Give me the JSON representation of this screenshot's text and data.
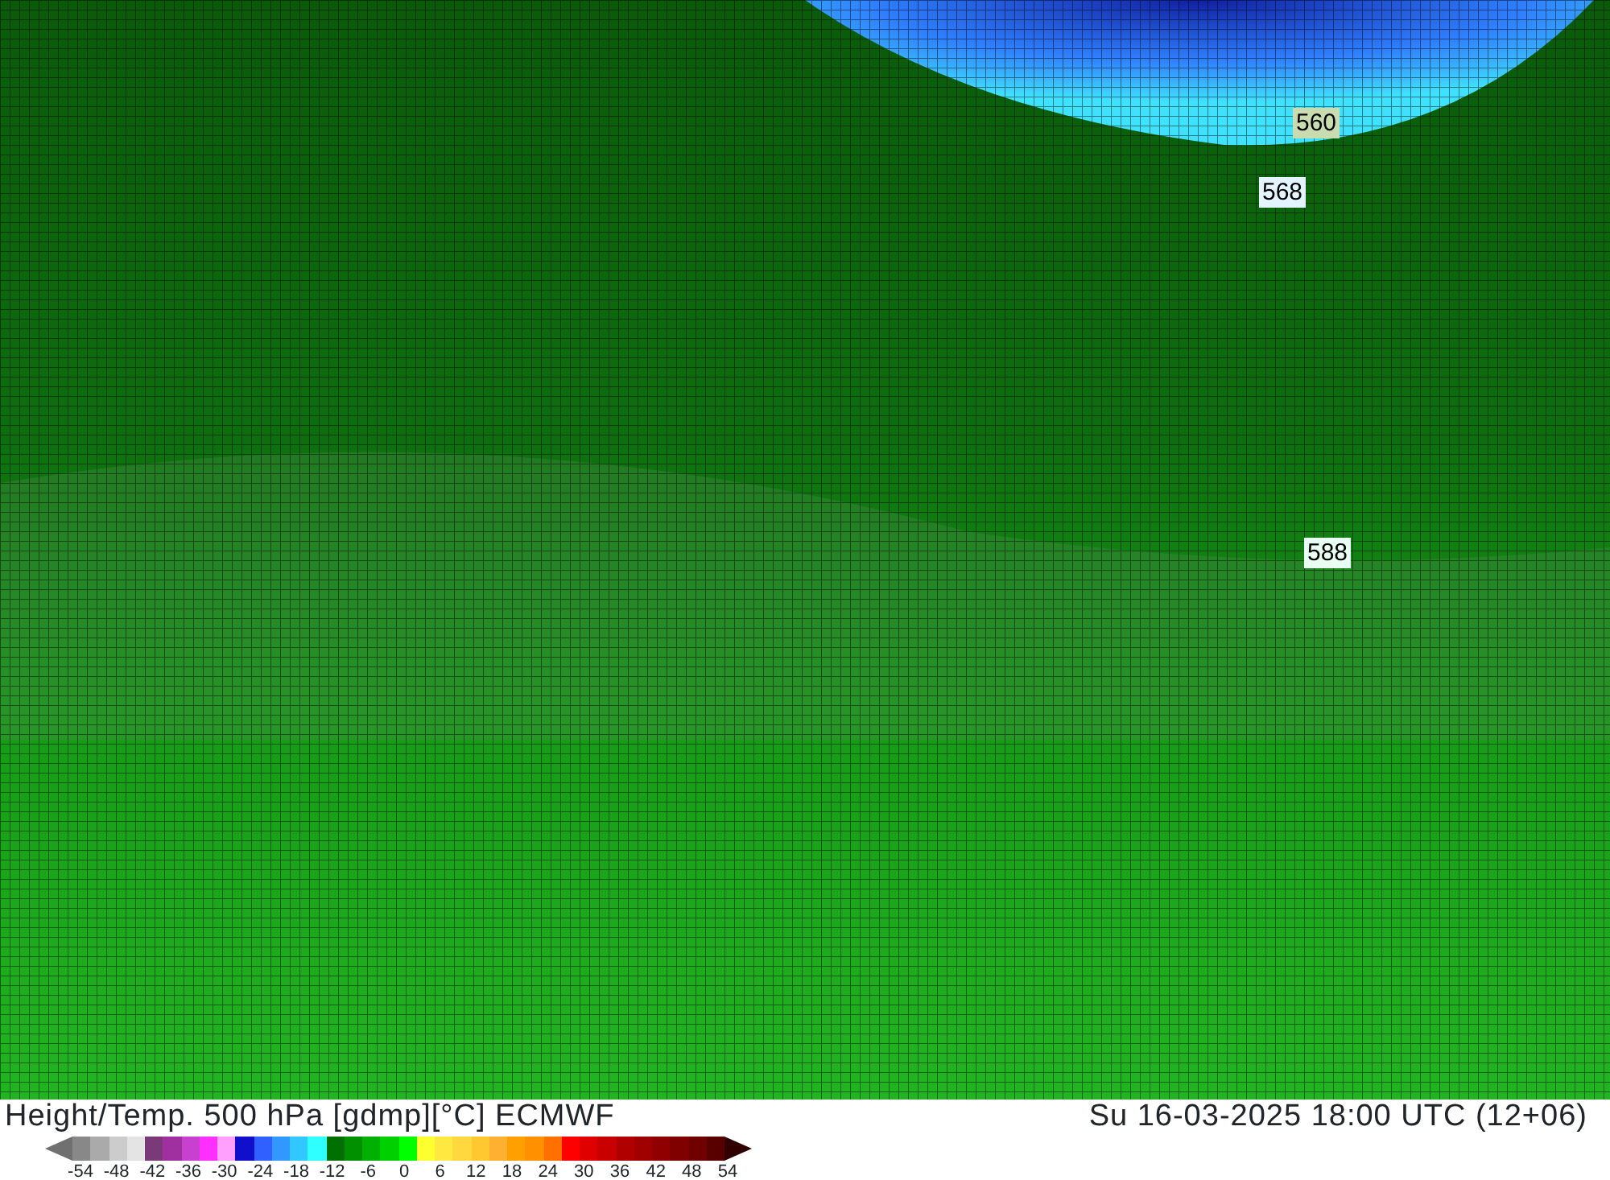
{
  "map": {
    "contour_labels": [
      {
        "text": "560",
        "color": "#c8dcb0"
      },
      {
        "text": "568",
        "color": "#e4f4ff"
      },
      {
        "text": "588",
        "color": "#e8fff4"
      }
    ]
  },
  "title": "Height/Temp. 500 hPa [gdmp][°C] ECMWF",
  "valid_time": "Su 16-03-2025 18:00 UTC (12+06)",
  "legend": {
    "arrows": [
      {
        "kind": "low",
        "color": "#707070"
      },
      {
        "kind": "high",
        "color": "#300000"
      }
    ],
    "swatches": [
      {
        "color": "#888888"
      },
      {
        "color": "#aaaaaa"
      },
      {
        "color": "#cccccc"
      },
      {
        "color": "#e4e4e4"
      },
      {
        "color": "#7a3a7a"
      },
      {
        "color": "#a030a0"
      },
      {
        "color": "#c840d0"
      },
      {
        "color": "#ff30ff"
      },
      {
        "color": "#ffa0ff"
      },
      {
        "color": "#1010cc"
      },
      {
        "color": "#3060ff"
      },
      {
        "color": "#3098ff"
      },
      {
        "color": "#30c8ff"
      },
      {
        "color": "#30ffff"
      },
      {
        "color": "#007000"
      },
      {
        "color": "#009000"
      },
      {
        "color": "#00b000"
      },
      {
        "color": "#00d000"
      },
      {
        "color": "#00ff00"
      },
      {
        "color": "#ffff30"
      },
      {
        "color": "#ffe840"
      },
      {
        "color": "#ffd840"
      },
      {
        "color": "#ffc830"
      },
      {
        "color": "#ffb030"
      },
      {
        "color": "#ffa000"
      },
      {
        "color": "#ff9000"
      },
      {
        "color": "#ff7000"
      },
      {
        "color": "#ff0000"
      },
      {
        "color": "#e00000"
      },
      {
        "color": "#c80000"
      },
      {
        "color": "#b00000"
      },
      {
        "color": "#a00000"
      },
      {
        "color": "#900000"
      },
      {
        "color": "#800000"
      },
      {
        "color": "#700000"
      },
      {
        "color": "#580000"
      }
    ],
    "ticks": [
      "-54",
      "-48",
      "-42",
      "-36",
      "-30",
      "-24",
      "-18",
      "-12",
      "-6",
      "0",
      "6",
      "12",
      "18",
      "24",
      "30",
      "36",
      "42",
      "48",
      "54"
    ]
  }
}
